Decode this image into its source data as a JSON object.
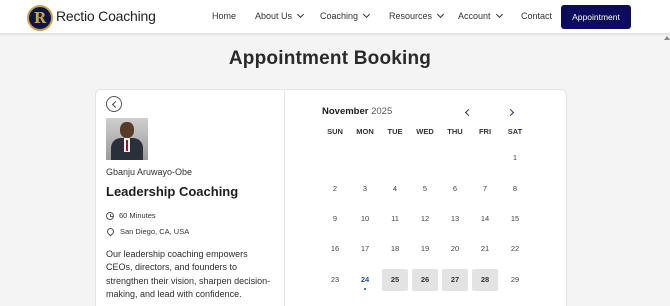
{
  "header": {
    "logo_letter": "R",
    "brand": "Rectio Coaching",
    "nav": [
      "Home",
      "About Us",
      "Coaching",
      "Resources",
      "Account",
      "Contact"
    ],
    "cta": "Appointment"
  },
  "page_title": "Appointment Booking",
  "coach": {
    "name": "Gbanju Aruwayo-Obe",
    "service": "Leadership Coaching",
    "duration": "60 Minutes",
    "location": "San Diego, CA, USA",
    "description": "Our leadership coaching empowers CEOs, directors, and founders to strengthen their vision, sharpen decision-making, and lead with confidence."
  },
  "calendar": {
    "month": "November",
    "year": "2025",
    "weekdays": [
      "SUN",
      "MON",
      "TUE",
      "WED",
      "THU",
      "FRI",
      "SAT"
    ],
    "weeks": [
      [
        "",
        "",
        "",
        "",
        "",
        "",
        "1"
      ],
      [
        "2",
        "3",
        "4",
        "5",
        "6",
        "7",
        "8"
      ],
      [
        "9",
        "10",
        "11",
        "12",
        "13",
        "14",
        "15"
      ],
      [
        "16",
        "17",
        "18",
        "19",
        "20",
        "21",
        "22"
      ],
      [
        "23",
        "24",
        "25",
        "26",
        "27",
        "28",
        "29"
      ]
    ],
    "today": "24",
    "available": [
      "25",
      "26",
      "27",
      "28"
    ]
  }
}
